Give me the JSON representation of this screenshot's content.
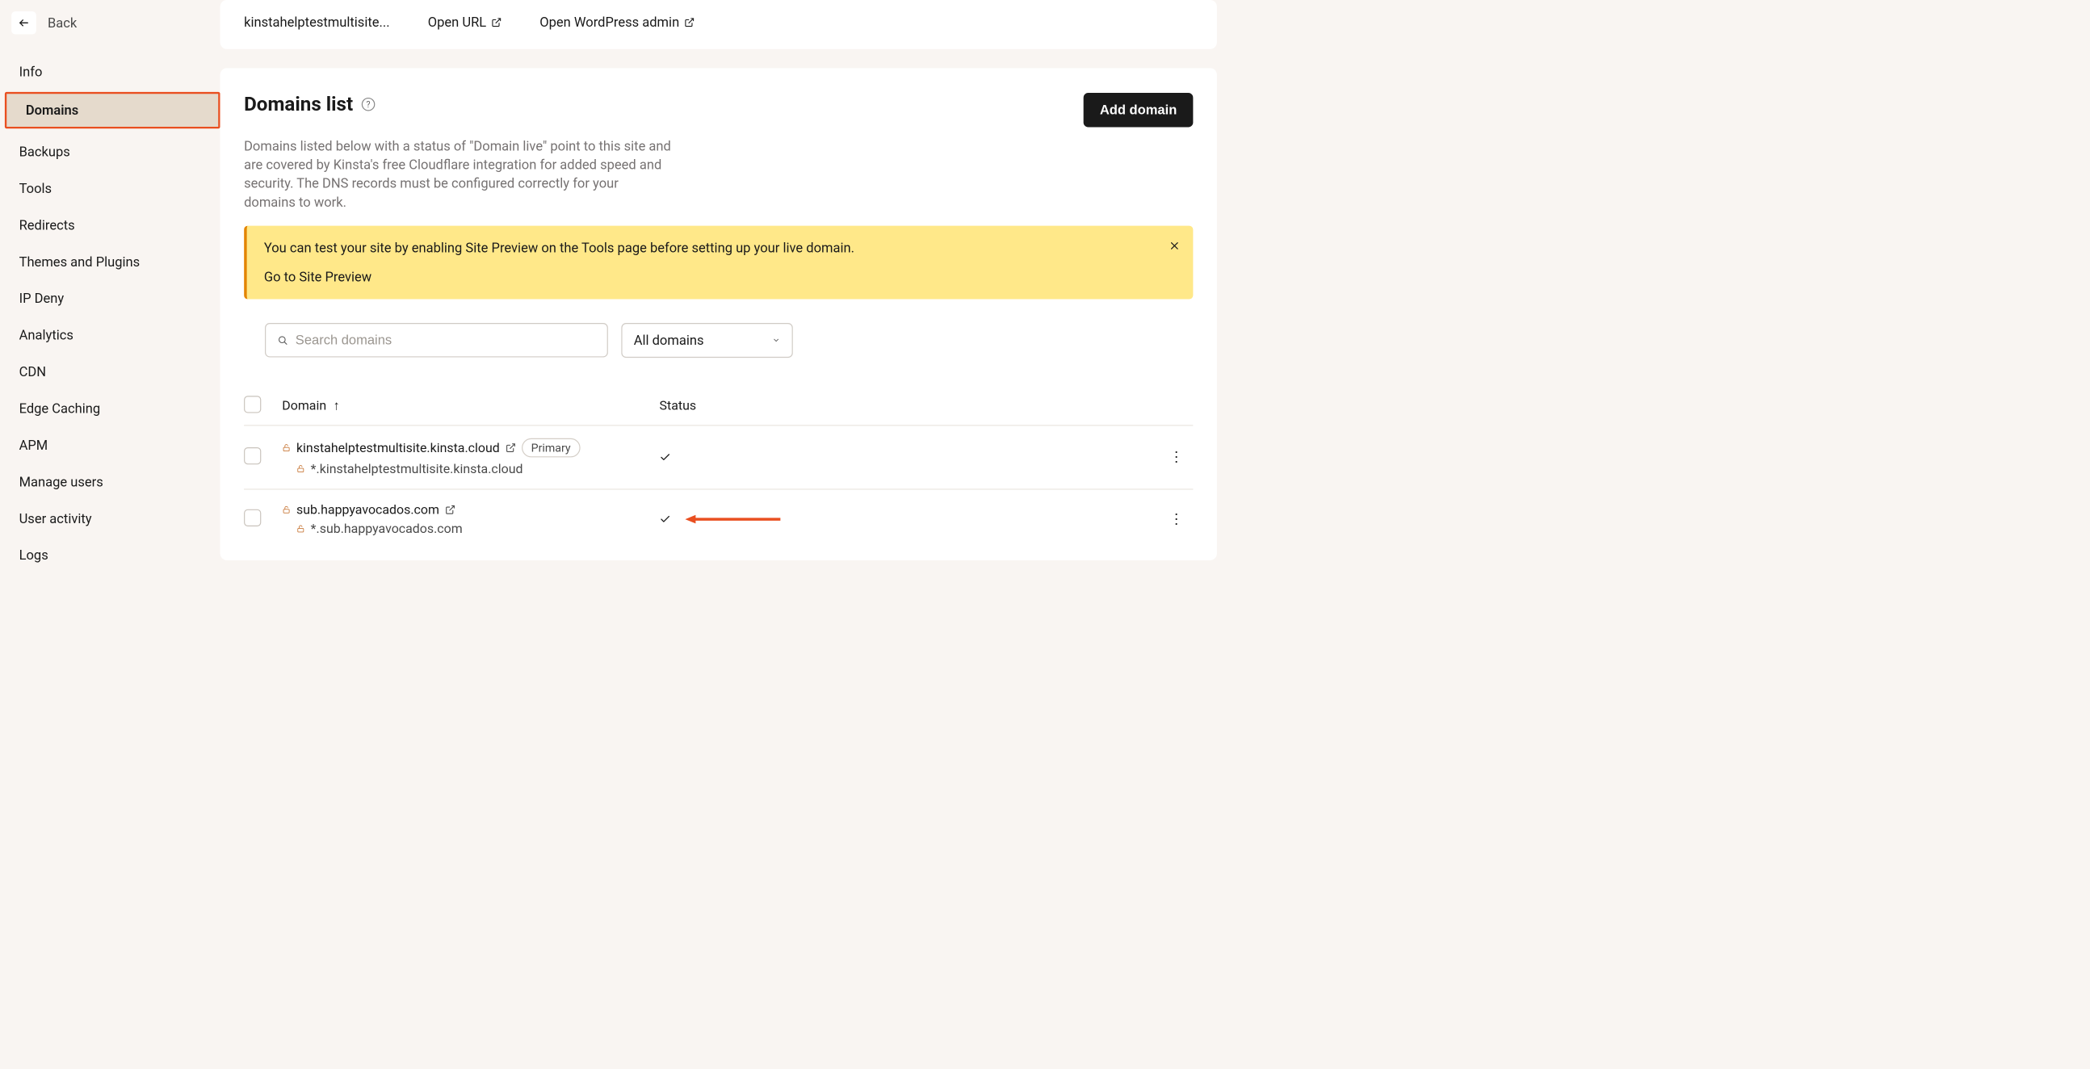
{
  "sidebar": {
    "back_label": "Back",
    "items": [
      {
        "label": "Info"
      },
      {
        "label": "Domains"
      },
      {
        "label": "Backups"
      },
      {
        "label": "Tools"
      },
      {
        "label": "Redirects"
      },
      {
        "label": "Themes and Plugins"
      },
      {
        "label": "IP Deny"
      },
      {
        "label": "Analytics"
      },
      {
        "label": "CDN"
      },
      {
        "label": "Edge Caching"
      },
      {
        "label": "APM"
      },
      {
        "label": "Manage users"
      },
      {
        "label": "User activity"
      },
      {
        "label": "Logs"
      }
    ]
  },
  "top": {
    "site_name": "kinstahelptestmultisite...",
    "open_url": "Open URL",
    "open_wp": "Open WordPress admin"
  },
  "page": {
    "title": "Domains list",
    "description": "Domains listed below with a status of \"Domain live\" point to this site and are covered by Kinsta's free Cloudflare integration for added speed and security. The DNS records must be configured correctly for your domains to work.",
    "add_button": "Add domain"
  },
  "banner": {
    "message": "You can test your site by enabling Site Preview on the Tools page before setting up your live domain.",
    "link": "Go to Site Preview"
  },
  "filters": {
    "search_placeholder": "Search domains",
    "select_value": "All domains"
  },
  "table": {
    "col_domain": "Domain",
    "col_status": "Status",
    "rows": [
      {
        "domain": "kinstahelptestmultisite.kinsta.cloud",
        "wildcard": "*.kinstahelptestmultisite.kinsta.cloud",
        "primary_badge": "Primary"
      },
      {
        "domain": "sub.happyavocados.com",
        "wildcard": "*.sub.happyavocados.com"
      }
    ]
  }
}
